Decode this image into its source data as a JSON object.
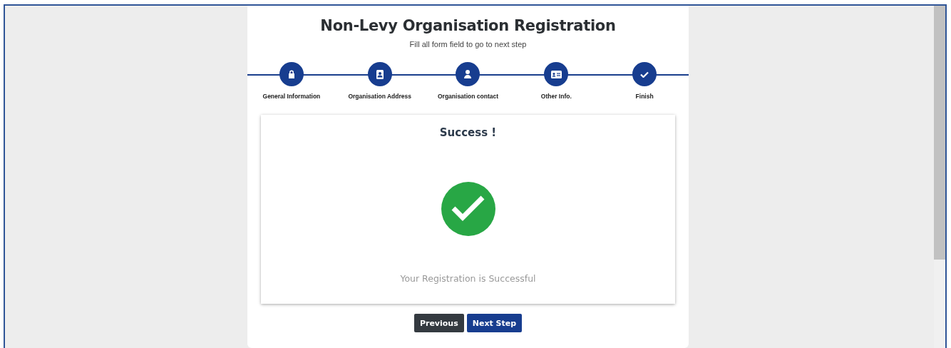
{
  "title": "Non-Levy Organisation Registration",
  "subtitle": "Fill all form field to go to next step",
  "steps": [
    {
      "label": "General Information",
      "kind": "lock"
    },
    {
      "label": "Organisation Address",
      "kind": "contacts"
    },
    {
      "label": "Organisation contact",
      "kind": "user"
    },
    {
      "label": "Other Info.",
      "kind": "card"
    },
    {
      "label": "Finish",
      "kind": "check"
    }
  ],
  "result": {
    "heading": "Success !",
    "message": "Your Registration is Successful"
  },
  "buttons": [
    {
      "label": "Previous",
      "kind": "secondary"
    },
    {
      "label": "Next Step",
      "kind": "primary"
    }
  ]
}
